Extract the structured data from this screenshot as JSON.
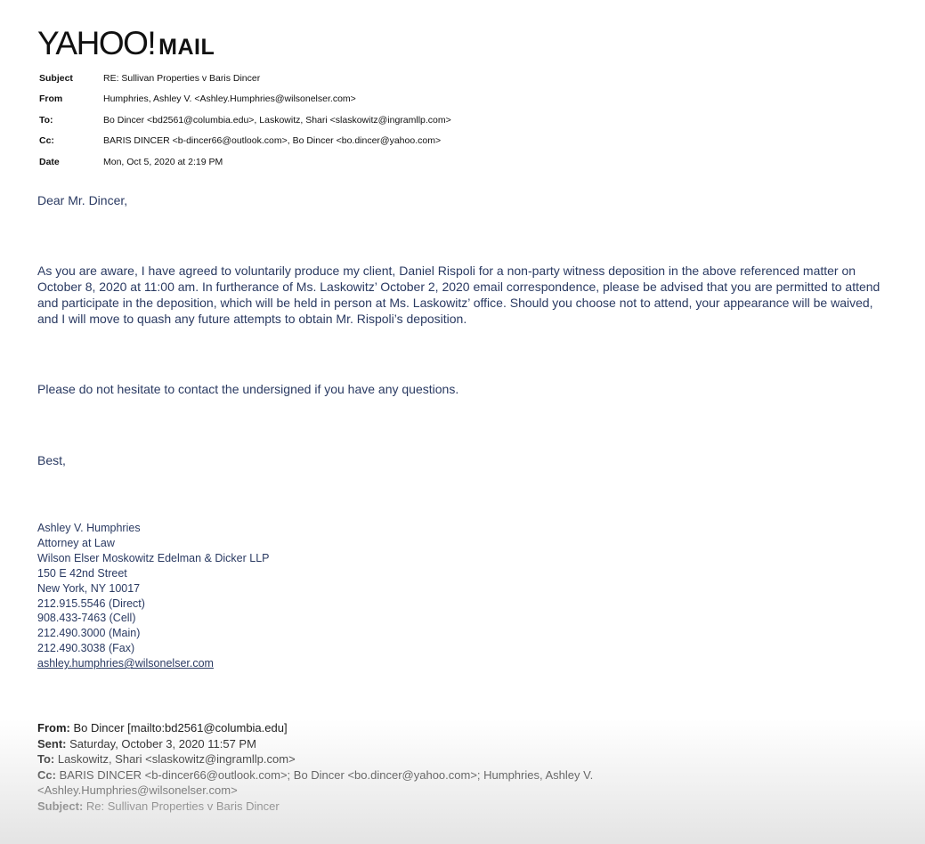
{
  "logo": {
    "yahoo": "YAHOO!",
    "mail": "MAIL"
  },
  "headers": {
    "subject_label": "Subject",
    "subject": "RE: Sullivan Properties v Baris Dincer",
    "from_label": "From",
    "from": "Humphries, Ashley V. <Ashley.Humphries@wilsonelser.com>",
    "to_label": "To:",
    "to": "Bo Dincer <bd2561@columbia.edu>, Laskowitz, Shari <slaskowitz@ingramllp.com>",
    "cc_label": "Cc:",
    "cc": "BARIS DINCER <b-dincer66@outlook.com>, Bo Dincer <bo.dincer@yahoo.com>",
    "date_label": "Date",
    "date": "Mon, Oct 5, 2020 at 2:19 PM"
  },
  "body": {
    "greeting": "Dear Mr. Dincer,",
    "paragraph": "As you are aware, I have agreed to voluntarily produce my client, Daniel Rispoli for a non-party witness deposition in the above referenced matter on October 8, 2020 at 11:00 am.  In furtherance of Ms. Laskowitz’ October 2, 2020 email correspondence, please be advised that you are permitted to attend and participate in the deposition, which will be held in person at Ms. Laskowitz’ office.  Should you choose not to attend, your appearance will be waived, and I will move to quash any future attempts to obtain Mr. Rispoli’s deposition.",
    "contact_line": "Please do not hesitate to contact the undersigned if you have any questions.",
    "closing": "Best,"
  },
  "signature": {
    "name": "Ashley V. Humphries",
    "title": "Attorney at Law",
    "firm": "Wilson Elser Moskowitz Edelman & Dicker LLP",
    "street": "150 E 42nd Street",
    "city": "New York, NY 10017",
    "direct": "212.915.5546 (Direct)",
    "cell": "908.433-7463 (Cell)",
    "main": "212.490.3000 (Main)",
    "fax": "212.490.3038 (Fax)",
    "email": "ashley.humphries@wilsonelser.com"
  },
  "forwarded": {
    "from_label": "From:",
    "from": "Bo Dincer [mailto:bd2561@columbia.edu]",
    "sent_label": "Sent:",
    "sent": "Saturday, October 3, 2020 11:57 PM",
    "to_label": "To:",
    "to": "Laskowitz, Shari <slaskowitz@ingramllp.com>",
    "cc_label": "Cc:",
    "cc_line1": "BARIS DINCER <b-dincer66@outlook.com>; Bo Dincer <bo.dincer@yahoo.com>; Humphries, Ashley V.",
    "cc_line2": "<Ashley.Humphries@wilsonelser.com>",
    "subject_label": "Subject:",
    "subject": "Re: Sullivan Properties v Baris Dincer"
  }
}
